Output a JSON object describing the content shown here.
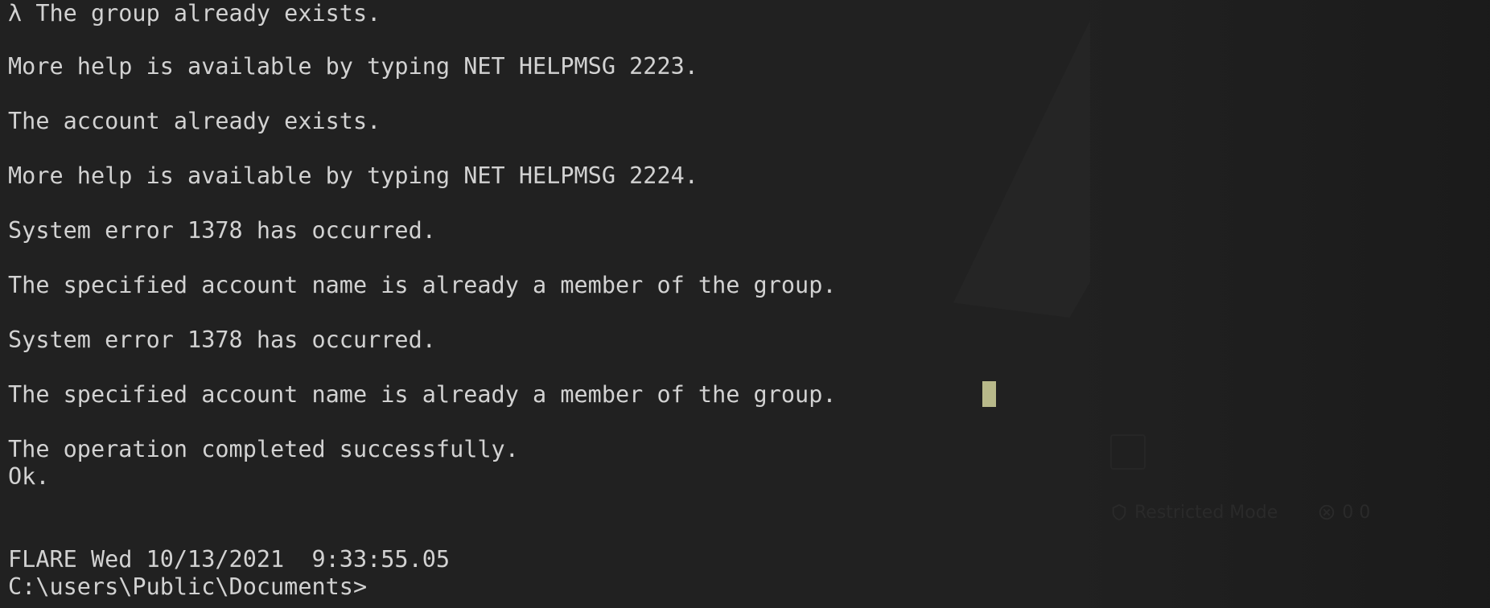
{
  "terminal": {
    "lines": [
      "λ The group already exists.",
      "More help is available by typing NET HELPMSG 2223.",
      "The account already exists.",
      "More help is available by typing NET HELPMSG 2224.",
      "System error 1378 has occurred.",
      "The specified account name is already a member of the group.",
      "System error 1378 has occurred.",
      "The specified account name is already a member of the group.",
      "The operation completed successfully.",
      "Ok."
    ],
    "status_line": "FLARE Wed 10/13/2021  9:33:55.05",
    "prompt": "C:\\users\\Public\\Documents>"
  },
  "background": {
    "status_bar": {
      "restricted_mode": "Restricted Mode",
      "problems": "0  0"
    }
  }
}
